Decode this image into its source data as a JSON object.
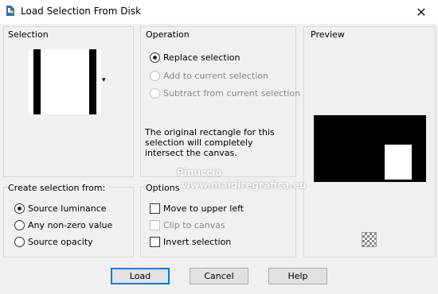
{
  "window": {
    "title": "Load Selection From Disk",
    "close_glyph": "✕"
  },
  "selection": {
    "label": "Selection",
    "dropdown_glyph": "▾"
  },
  "operation": {
    "label": "Operation",
    "options": [
      {
        "label": "Replace selection",
        "checked": true,
        "enabled": true
      },
      {
        "label": "Add to current selection",
        "checked": false,
        "enabled": false
      },
      {
        "label": "Subtract from current selection",
        "checked": false,
        "enabled": false
      }
    ],
    "description": "The original rectangle for this selection will completely intersect the canvas."
  },
  "preview": {
    "label": "Preview"
  },
  "create_from": {
    "label": "Create selection from:",
    "options": [
      {
        "label": "Source luminance",
        "checked": true
      },
      {
        "label": "Any non-zero value",
        "checked": false
      },
      {
        "label": "Source opacity",
        "checked": false
      }
    ]
  },
  "options": {
    "label": "Options",
    "checks": [
      {
        "label": "Move to upper left",
        "checked": false,
        "enabled": true
      },
      {
        "label": "Clip to canvas",
        "checked": false,
        "enabled": false
      },
      {
        "label": "Invert selection",
        "checked": false,
        "enabled": true
      }
    ]
  },
  "buttons": {
    "load": "Load",
    "cancel": "Cancel",
    "help": "Help"
  },
  "watermark": {
    "line1": "Pinuccia",
    "line2": "www.maidiregrafica.eu"
  },
  "icons": [
    "app-icon",
    "close-icon",
    "dropdown-arrow-icon",
    "checkerboard-icon"
  ],
  "colors": {
    "accent": "#0078d7",
    "background": "#f0f0f0"
  }
}
